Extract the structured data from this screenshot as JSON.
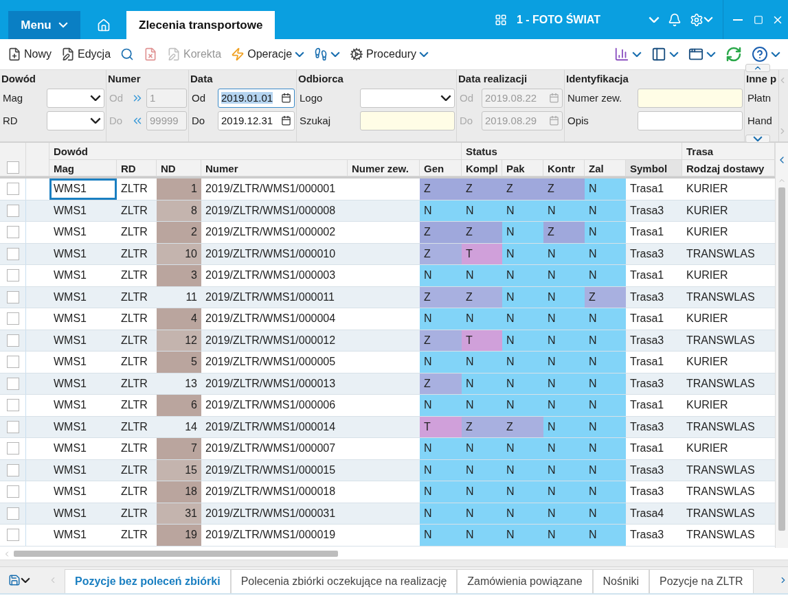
{
  "titlebar": {
    "menu": "Menu",
    "tab": "Zlecenia transportowe",
    "company": "1 - FOTO ŚWIAT"
  },
  "toolbar": [
    {
      "kind": "new",
      "label": "Nowy",
      "disabled": false
    },
    {
      "kind": "edit",
      "label": "Edycja",
      "disabled": false
    },
    {
      "kind": "find",
      "disabled": false
    },
    {
      "kind": "delete",
      "disabled": true
    },
    {
      "kind": "correct",
      "label": "Korekta",
      "disabled": true
    },
    {
      "kind": "operations",
      "label": "Operacje",
      "disabled": false
    },
    {
      "kind": "steps",
      "disabled": false
    },
    {
      "kind": "procedures",
      "label": "Procedury",
      "disabled": false
    }
  ],
  "filters": [
    {
      "title": "Dowód",
      "fields": [
        {
          "kind": "select",
          "label": "Mag",
          "disabled": false
        },
        {
          "kind": "select",
          "label": "RD",
          "disabled": false
        }
      ]
    },
    {
      "title": "Numer",
      "fields": [
        {
          "kind": "range",
          "label": "Od",
          "value": "1",
          "disabled": true
        },
        {
          "kind": "range",
          "label": "Do",
          "value": "99999",
          "disabled": true
        }
      ]
    },
    {
      "title": "Data",
      "fields": [
        {
          "kind": "date",
          "label": "Od",
          "value": "2019.01.01",
          "disabled": false,
          "text_selected": true
        },
        {
          "kind": "date",
          "label": "Do",
          "value": "2019.12.31",
          "disabled": false,
          "text_selected": false
        }
      ]
    },
    {
      "title": "Odbiorca",
      "fields": [
        {
          "kind": "select",
          "label": "Logo",
          "disabled": false
        },
        {
          "kind": "search",
          "label": "Szukaj",
          "disabled": false
        }
      ]
    },
    {
      "title": "Data realizacji",
      "fields": [
        {
          "kind": "date",
          "label": "Od",
          "value": "2019.08.22",
          "disabled": true,
          "text_selected": false
        },
        {
          "kind": "date",
          "label": "Do",
          "value": "2019.08.29",
          "disabled": true,
          "text_selected": false
        }
      ]
    },
    {
      "title": "Identyfikacja",
      "fields": [
        {
          "kind": "search",
          "label": "Numer zew.",
          "disabled": false
        },
        {
          "kind": "text",
          "label": "Opis",
          "disabled": false
        }
      ]
    },
    {
      "title": "Inne p",
      "fields": [
        {
          "kind": "label",
          "label": "Płatn"
        },
        {
          "kind": "label",
          "label": "Hand"
        }
      ]
    }
  ],
  "table": {
    "header_checked": false,
    "groups": [
      "Dowód",
      "Status",
      "Trasa"
    ],
    "columns": [
      "Mag",
      "RD",
      "ND",
      "Numer",
      "Numer zew.",
      "Gen",
      "Kompl",
      "Pak",
      "Kontr",
      "Zal",
      "Symbol",
      "Rodzaj dostawy"
    ],
    "rows": [
      {
        "checked": false,
        "focused": true,
        "mag": "WMS1",
        "rd": "ZLTR",
        "nd": "1",
        "nd_flagged": true,
        "numer": "2019/ZLTR/WMS1/000001",
        "status": [
          {
            "value": "Z",
            "color": "#9fa8dc"
          },
          {
            "value": "Z",
            "color": "#9fa8dc"
          },
          {
            "value": "Z",
            "color": "#9fa8dc"
          },
          {
            "value": "Z",
            "color": "#9fa8dc"
          },
          {
            "value": "N",
            "color": "#82d4f8"
          }
        ],
        "symbol": "Trasa1",
        "delivery": "KURIER"
      },
      {
        "checked": false,
        "focused": false,
        "mag": "WMS1",
        "rd": "ZLTR",
        "nd": "8",
        "nd_flagged": true,
        "numer": "2019/ZLTR/WMS1/000008",
        "status": [
          {
            "value": "N",
            "color": "#82d4f8"
          },
          {
            "value": "N",
            "color": "#82d4f8"
          },
          {
            "value": "N",
            "color": "#82d4f8"
          },
          {
            "value": "N",
            "color": "#82d4f8"
          },
          {
            "value": "N",
            "color": "#82d4f8"
          }
        ],
        "symbol": "Trasa3",
        "delivery": "KURIER"
      },
      {
        "checked": false,
        "focused": false,
        "mag": "WMS1",
        "rd": "ZLTR",
        "nd": "2",
        "nd_flagged": true,
        "numer": "2019/ZLTR/WMS1/000002",
        "status": [
          {
            "value": "Z",
            "color": "#9fa8dc"
          },
          {
            "value": "Z",
            "color": "#9fa8dc"
          },
          {
            "value": "N",
            "color": "#82d4f8"
          },
          {
            "value": "Z",
            "color": "#9fa8dc"
          },
          {
            "value": "N",
            "color": "#82d4f8"
          }
        ],
        "symbol": "Trasa1",
        "delivery": "KURIER"
      },
      {
        "checked": false,
        "focused": false,
        "mag": "WMS1",
        "rd": "ZLTR",
        "nd": "10",
        "nd_flagged": true,
        "numer": "2019/ZLTR/WMS1/000010",
        "status": [
          {
            "value": "Z",
            "color": "#a8b0e0"
          },
          {
            "value": "T",
            "color": "#d0a0da"
          },
          {
            "value": "N",
            "color": "#82d4f8"
          },
          {
            "value": "N",
            "color": "#82d4f8"
          },
          {
            "value": "N",
            "color": "#82d4f8"
          }
        ],
        "symbol": "Trasa3",
        "delivery": "TRANSWLAS"
      },
      {
        "checked": false,
        "focused": false,
        "mag": "WMS1",
        "rd": "ZLTR",
        "nd": "3",
        "nd_flagged": true,
        "numer": "2019/ZLTR/WMS1/000003",
        "status": [
          {
            "value": "N",
            "color": "#82d4f8"
          },
          {
            "value": "N",
            "color": "#82d4f8"
          },
          {
            "value": "N",
            "color": "#82d4f8"
          },
          {
            "value": "N",
            "color": "#82d4f8"
          },
          {
            "value": "N",
            "color": "#82d4f8"
          }
        ],
        "symbol": "Trasa1",
        "delivery": "KURIER"
      },
      {
        "checked": false,
        "focused": false,
        "mag": "WMS1",
        "rd": "ZLTR",
        "nd": "11",
        "nd_flagged": false,
        "numer": "2019/ZLTR/WMS1/000011",
        "status": [
          {
            "value": "Z",
            "color": "#a8b0e0"
          },
          {
            "value": "Z",
            "color": "#a8b0e0"
          },
          {
            "value": "N",
            "color": "#82d4f8"
          },
          {
            "value": "N",
            "color": "#82d4f8"
          },
          {
            "value": "Z",
            "color": "#a8b0e0"
          }
        ],
        "symbol": "Trasa3",
        "delivery": "TRANSWLAS"
      },
      {
        "checked": false,
        "focused": false,
        "mag": "WMS1",
        "rd": "ZLTR",
        "nd": "4",
        "nd_flagged": true,
        "numer": "2019/ZLTR/WMS1/000004",
        "status": [
          {
            "value": "N",
            "color": "#82d4f8"
          },
          {
            "value": "N",
            "color": "#82d4f8"
          },
          {
            "value": "N",
            "color": "#82d4f8"
          },
          {
            "value": "N",
            "color": "#82d4f8"
          },
          {
            "value": "N",
            "color": "#82d4f8"
          }
        ],
        "symbol": "Trasa1",
        "delivery": "KURIER"
      },
      {
        "checked": false,
        "focused": false,
        "mag": "WMS1",
        "rd": "ZLTR",
        "nd": "12",
        "nd_flagged": true,
        "numer": "2019/ZLTR/WMS1/000012",
        "status": [
          {
            "value": "Z",
            "color": "#a8b0e0"
          },
          {
            "value": "T",
            "color": "#d0a0da"
          },
          {
            "value": "N",
            "color": "#82d4f8"
          },
          {
            "value": "N",
            "color": "#82d4f8"
          },
          {
            "value": "N",
            "color": "#82d4f8"
          }
        ],
        "symbol": "Trasa3",
        "delivery": "TRANSWLAS"
      },
      {
        "checked": false,
        "focused": false,
        "mag": "WMS1",
        "rd": "ZLTR",
        "nd": "5",
        "nd_flagged": true,
        "numer": "2019/ZLTR/WMS1/000005",
        "status": [
          {
            "value": "N",
            "color": "#82d4f8"
          },
          {
            "value": "N",
            "color": "#82d4f8"
          },
          {
            "value": "N",
            "color": "#82d4f8"
          },
          {
            "value": "N",
            "color": "#82d4f8"
          },
          {
            "value": "N",
            "color": "#82d4f8"
          }
        ],
        "symbol": "Trasa1",
        "delivery": "KURIER"
      },
      {
        "checked": false,
        "focused": false,
        "mag": "WMS1",
        "rd": "ZLTR",
        "nd": "13",
        "nd_flagged": false,
        "numer": "2019/ZLTR/WMS1/000013",
        "status": [
          {
            "value": "Z",
            "color": "#a8b0e0"
          },
          {
            "value": "N",
            "color": "#82d4f8"
          },
          {
            "value": "N",
            "color": "#82d4f8"
          },
          {
            "value": "N",
            "color": "#82d4f8"
          },
          {
            "value": "N",
            "color": "#82d4f8"
          }
        ],
        "symbol": "Trasa3",
        "delivery": "TRANSWLAS"
      },
      {
        "checked": false,
        "focused": false,
        "mag": "WMS1",
        "rd": "ZLTR",
        "nd": "6",
        "nd_flagged": true,
        "numer": "2019/ZLTR/WMS1/000006",
        "status": [
          {
            "value": "N",
            "color": "#82d4f8"
          },
          {
            "value": "N",
            "color": "#82d4f8"
          },
          {
            "value": "N",
            "color": "#82d4f8"
          },
          {
            "value": "N",
            "color": "#82d4f8"
          },
          {
            "value": "N",
            "color": "#82d4f8"
          }
        ],
        "symbol": "Trasa1",
        "delivery": "KURIER"
      },
      {
        "checked": false,
        "focused": false,
        "mag": "WMS1",
        "rd": "ZLTR",
        "nd": "14",
        "nd_flagged": false,
        "numer": "2019/ZLTR/WMS1/000014",
        "status": [
          {
            "value": "T",
            "color": "#d0a0da"
          },
          {
            "value": "Z",
            "color": "#a8b0e0"
          },
          {
            "value": "Z",
            "color": "#a8b0e0"
          },
          {
            "value": "N",
            "color": "#82d4f8"
          },
          {
            "value": "N",
            "color": "#82d4f8"
          }
        ],
        "symbol": "Trasa3",
        "delivery": "TRANSWLAS"
      },
      {
        "checked": false,
        "focused": false,
        "mag": "WMS1",
        "rd": "ZLTR",
        "nd": "7",
        "nd_flagged": true,
        "numer": "2019/ZLTR/WMS1/000007",
        "status": [
          {
            "value": "N",
            "color": "#82d4f8"
          },
          {
            "value": "N",
            "color": "#82d4f8"
          },
          {
            "value": "N",
            "color": "#82d4f8"
          },
          {
            "value": "N",
            "color": "#82d4f8"
          },
          {
            "value": "N",
            "color": "#82d4f8"
          }
        ],
        "symbol": "Trasa1",
        "delivery": "KURIER"
      },
      {
        "checked": false,
        "focused": false,
        "mag": "WMS1",
        "rd": "ZLTR",
        "nd": "15",
        "nd_flagged": true,
        "numer": "2019/ZLTR/WMS1/000015",
        "status": [
          {
            "value": "N",
            "color": "#82d4f8"
          },
          {
            "value": "N",
            "color": "#82d4f8"
          },
          {
            "value": "N",
            "color": "#82d4f8"
          },
          {
            "value": "N",
            "color": "#82d4f8"
          },
          {
            "value": "N",
            "color": "#82d4f8"
          }
        ],
        "symbol": "Trasa3",
        "delivery": "TRANSWLAS"
      },
      {
        "checked": false,
        "focused": false,
        "mag": "WMS1",
        "rd": "ZLTR",
        "nd": "18",
        "nd_flagged": true,
        "numer": "2019/ZLTR/WMS1/000018",
        "status": [
          {
            "value": "N",
            "color": "#82d4f8"
          },
          {
            "value": "N",
            "color": "#82d4f8"
          },
          {
            "value": "N",
            "color": "#82d4f8"
          },
          {
            "value": "N",
            "color": "#82d4f8"
          },
          {
            "value": "N",
            "color": "#82d4f8"
          }
        ],
        "symbol": "Trasa3",
        "delivery": "TRANSWLAS"
      },
      {
        "checked": false,
        "focused": false,
        "mag": "WMS1",
        "rd": "ZLTR",
        "nd": "31",
        "nd_flagged": true,
        "numer": "2019/ZLTR/WMS1/000031",
        "status": [
          {
            "value": "N",
            "color": "#82d4f8"
          },
          {
            "value": "N",
            "color": "#82d4f8"
          },
          {
            "value": "N",
            "color": "#82d4f8"
          },
          {
            "value": "N",
            "color": "#82d4f8"
          },
          {
            "value": "N",
            "color": "#82d4f8"
          }
        ],
        "symbol": "Trasa4",
        "delivery": "TRANSWLAS"
      },
      {
        "checked": false,
        "focused": false,
        "mag": "WMS1",
        "rd": "ZLTR",
        "nd": "19",
        "nd_flagged": true,
        "numer": "2019/ZLTR/WMS1/000019",
        "status": [
          {
            "value": "N",
            "color": "#82d4f8"
          },
          {
            "value": "N",
            "color": "#82d4f8"
          },
          {
            "value": "N",
            "color": "#82d4f8"
          },
          {
            "value": "N",
            "color": "#82d4f8"
          },
          {
            "value": "N",
            "color": "#82d4f8"
          }
        ],
        "symbol": "Trasa3",
        "delivery": "TRANSWLAS"
      }
    ]
  },
  "bottom_tabs": [
    {
      "label": "Pozycje bez poleceń zbiórki",
      "selected": true
    },
    {
      "label": "Polecenia zbiórki oczekujące na realizację",
      "selected": false
    },
    {
      "label": "Zamówienia powiązane",
      "selected": false
    },
    {
      "label": "Nośniki",
      "selected": false
    },
    {
      "label": "Pozycje na ZLTR",
      "selected": false
    }
  ]
}
